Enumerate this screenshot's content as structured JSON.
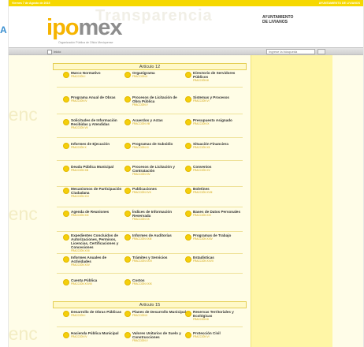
{
  "left_glyph": "A",
  "topbar": {
    "left_text": "Viernes 7 de Agosto de 2015",
    "right_text": "AYUNTAMIENTO DE LIVIANOS"
  },
  "header": {
    "watermark": "Transparencia",
    "logo": {
      "i": "i",
      "po": "po",
      "mex": "mex"
    },
    "tagline": "Organización Pública de Oficio Mexiquense",
    "ayto": "AYUNTAMIENTO DE LIVIANOS"
  },
  "toolbar": {
    "home_label": "Inicio",
    "search_placeholder": "Ingrese la búsqueda"
  },
  "background_words": [
    "renc",
    "transparenc",
    "renc",
    "renc",
    "transparenc",
    "renc"
  ],
  "sections": [
    {
      "title": "Artículo 12",
      "items": [
        {
          "label": "Marco Normativo",
          "sub": "FRACCIÓN I"
        },
        {
          "label": "Organigrama",
          "sub": "FRACCIÓN II"
        },
        {
          "label": "Directorio de Servidores Públicos",
          "sub": "FRACCIÓN III"
        },
        {
          "label": "Programa Anual de Obras",
          "sub": "FRACCIÓN IV"
        },
        {
          "label": "Procesos de Licitación de Obra Pública",
          "sub": "FRACCIÓN V"
        },
        {
          "label": "Sistemas y Procesos",
          "sub": "FRACCIÓN VI"
        },
        {
          "label": "Solicitudes de Información Recibidas y Atendidas",
          "sub": "FRACCIÓN VII"
        },
        {
          "label": "Acuerdos y Actas",
          "sub": "FRACCIÓN VIII"
        },
        {
          "label": "Presupuesto Asignado",
          "sub": "FRACCIÓN IX"
        },
        {
          "label": "Informes de Ejecución",
          "sub": "FRACCIÓN X"
        },
        {
          "label": "Programas de Subsidio",
          "sub": "FRACCIÓN XI"
        },
        {
          "label": "Situación Financiera",
          "sub": "FRACCIÓN XII"
        },
        {
          "label": "Deuda Pública Municipal",
          "sub": "FRACCIÓN XIII"
        },
        {
          "label": "Procesos de Licitación y Contratación",
          "sub": "FRACCIÓN XIV"
        },
        {
          "label": "Convenios",
          "sub": "FRACCIÓN XV"
        },
        {
          "label": "Mecanismos de Participación Ciudadana",
          "sub": "FRACCIÓN XVI"
        },
        {
          "label": "Publicaciones",
          "sub": "FRACCIÓN XVII"
        },
        {
          "label": "Boletines",
          "sub": "FRACCIÓN XVIII"
        },
        {
          "label": "Agenda de Reuniones",
          "sub": "FRACCIÓN XIX"
        },
        {
          "label": "Índices de Información Reservada",
          "sub": "FRACCIÓN XX"
        },
        {
          "label": "Bases de Datos Personales",
          "sub": "FRACCIÓN XXI"
        },
        {
          "label": "Expedientes Concluidos de Autorizaciones, Permisos, Licencias, Certificaciones y Concesiones",
          "sub": "FRACCIÓN XXII"
        },
        {
          "label": "Informes de Auditorías",
          "sub": "FRACCIÓN XXIII"
        },
        {
          "label": "Programas de Trabajo",
          "sub": "FRACCIÓN XXIV"
        },
        {
          "label": "Informes Anuales de Actividades",
          "sub": "FRACCIÓN XXV"
        },
        {
          "label": "Trámites y Servicios",
          "sub": "FRACCIÓN XXVI"
        },
        {
          "label": "Estadísticas",
          "sub": "FRACCIÓN XXVII"
        },
        {
          "label": "Cuenta Pública",
          "sub": "FRACCIÓN XXVIII"
        },
        {
          "label": "Costos",
          "sub": "FRACCIÓN XXIX"
        }
      ]
    },
    {
      "title": "Artículo 15",
      "items": [
        {
          "label": "Desarrollo de Obras Públicas",
          "sub": "FRACCIÓN I"
        },
        {
          "label": "Planes de Desarrollo Municipal",
          "sub": "FRACCIÓN II"
        },
        {
          "label": "Reservas Territoriales y Ecológicas",
          "sub": "FRACCIÓN III"
        },
        {
          "label": "Hacienda Pública Municipal",
          "sub": "FRACCIÓN IV"
        },
        {
          "label": "Valores Unitarios de Suelo y Construcciones",
          "sub": "FRACCIÓN V"
        },
        {
          "label": "Protección Civil",
          "sub": "FRACCIÓN VI"
        }
      ]
    }
  ]
}
